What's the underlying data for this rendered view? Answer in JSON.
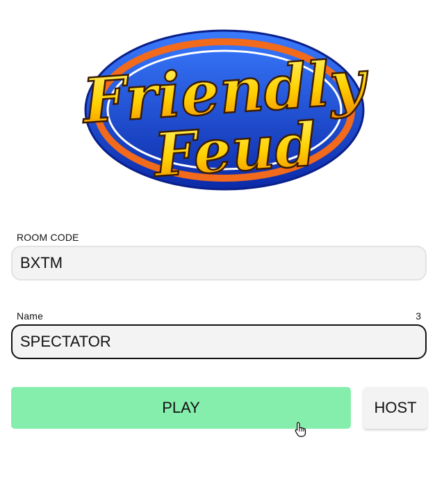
{
  "logo": {
    "line1": "Friendly",
    "line2": "Feud",
    "colors": {
      "ellipse_blue": "#1f46c8",
      "ring_orange": "#f26a1b",
      "text_gold": "#ffd000"
    }
  },
  "room_code": {
    "label": "ROOM CODE",
    "value": "BXTM"
  },
  "name": {
    "label": "Name",
    "value": "SPECTATOR",
    "remaining_chars": "3"
  },
  "actions": {
    "play_label": "PLAY",
    "host_label": "HOST",
    "play_color": "#86eeac"
  },
  "cursor_icon": "hand-pointer-icon"
}
